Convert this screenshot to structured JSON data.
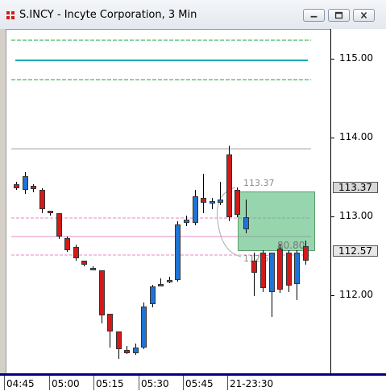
{
  "window": {
    "title": "S.INCY - Incyte Corporation, 3 Min",
    "controls": {
      "minimize": "minimize",
      "restore": "restore",
      "close": "close"
    }
  },
  "colors": {
    "up_candle": "#1e74d6",
    "down_candle": "#d21a1a",
    "target_band": "#1aa63a",
    "center_line": "#19a9b4",
    "pink_line": "#e589c7",
    "zone": "#5cb878",
    "selection_border": "#000082"
  },
  "chart_data": {
    "type": "candlestick",
    "y_ticks": [
      "115.00",
      "114.00",
      "113.00",
      "112.00"
    ],
    "x_ticks": [
      "04:45",
      "05:00",
      "05:15",
      "05:30",
      "05:45",
      "21-23:30"
    ],
    "ylim": [
      111.05,
      115.35
    ],
    "price_labels": {
      "upper": "113.37",
      "last": "112.57"
    },
    "zone_labels": {
      "top": "113.37",
      "value": "80.80",
      "bottom": "112.5"
    },
    "levels": {
      "green_top": 115.25,
      "cyan": 115.0,
      "green_low": 114.74,
      "gray": 113.87,
      "pink_top": 112.99,
      "pink_mid": 112.76,
      "pink_low": 112.52
    },
    "candles": [
      {
        "t": "04:42",
        "o": 113.42,
        "h": 113.45,
        "l": 113.35,
        "c": 113.37
      },
      {
        "t": "04:45",
        "o": 113.35,
        "h": 113.57,
        "l": 113.3,
        "c": 113.52
      },
      {
        "t": "04:48",
        "o": 113.4,
        "h": 113.42,
        "l": 113.32,
        "c": 113.36
      },
      {
        "t": "04:51",
        "o": 113.35,
        "h": 113.37,
        "l": 113.05,
        "c": 113.1
      },
      {
        "t": "04:54",
        "o": 113.08,
        "h": 113.08,
        "l": 113.02,
        "c": 113.05
      },
      {
        "t": "04:57",
        "o": 113.05,
        "h": 113.05,
        "l": 112.72,
        "c": 112.75
      },
      {
        "t": "05:00",
        "o": 112.73,
        "h": 112.76,
        "l": 112.56,
        "c": 112.58
      },
      {
        "t": "05:03",
        "o": 112.62,
        "h": 112.65,
        "l": 112.45,
        "c": 112.48
      },
      {
        "t": "05:06",
        "o": 112.45,
        "h": 112.45,
        "l": 112.38,
        "c": 112.4
      },
      {
        "t": "05:09",
        "o": 112.36,
        "h": 112.38,
        "l": 112.35,
        "c": 112.36
      },
      {
        "t": "05:12",
        "o": 112.33,
        "h": 112.33,
        "l": 111.65,
        "c": 111.75
      },
      {
        "t": "05:15",
        "o": 111.78,
        "h": 111.78,
        "l": 111.35,
        "c": 111.55
      },
      {
        "t": "05:18",
        "o": 111.55,
        "h": 111.55,
        "l": 111.2,
        "c": 111.33
      },
      {
        "t": "05:21",
        "o": 111.32,
        "h": 111.37,
        "l": 111.27,
        "c": 111.28
      },
      {
        "t": "05:24",
        "o": 111.28,
        "h": 111.4,
        "l": 111.26,
        "c": 111.35
      },
      {
        "t": "05:27",
        "o": 111.35,
        "h": 111.92,
        "l": 111.33,
        "c": 111.87
      },
      {
        "t": "05:30",
        "o": 111.9,
        "h": 112.14,
        "l": 111.86,
        "c": 112.12
      },
      {
        "t": "05:33",
        "o": 112.13,
        "h": 112.22,
        "l": 112.12,
        "c": 112.15
      },
      {
        "t": "05:36",
        "o": 112.18,
        "h": 112.24,
        "l": 112.16,
        "c": 112.2
      },
      {
        "t": "05:39",
        "o": 112.2,
        "h": 112.95,
        "l": 112.18,
        "c": 112.91
      },
      {
        "t": "05:42",
        "o": 112.93,
        "h": 113.02,
        "l": 112.89,
        "c": 112.97
      },
      {
        "t": "05:45",
        "o": 112.93,
        "h": 113.35,
        "l": 112.9,
        "c": 113.27
      },
      {
        "t": "05:48",
        "o": 113.25,
        "h": 113.55,
        "l": 113.05,
        "c": 113.18
      },
      {
        "t": "05:51",
        "o": 113.18,
        "h": 113.25,
        "l": 113.1,
        "c": 113.2
      },
      {
        "t": "05:54",
        "o": 113.18,
        "h": 113.45,
        "l": 113.15,
        "c": 113.22
      },
      {
        "t": "05:57",
        "o": 113.8,
        "h": 113.91,
        "l": 112.95,
        "c": 113.0
      },
      {
        "t": "06:00",
        "o": 113.35,
        "h": 113.38,
        "l": 113.0,
        "c": 113.03
      },
      {
        "t": "06:03",
        "o": 112.85,
        "h": 113.22,
        "l": 112.8,
        "c": 113.0
      },
      {
        "t": "06:06",
        "o": 112.45,
        "h": 112.55,
        "l": 112.0,
        "c": 112.3
      },
      {
        "t": "06:09",
        "o": 112.55,
        "h": 112.58,
        "l": 112.05,
        "c": 112.1
      },
      {
        "t": "06:12",
        "o": 112.05,
        "h": 112.55,
        "l": 111.73,
        "c": 112.55
      },
      {
        "t": "06:15",
        "o": 112.6,
        "h": 112.66,
        "l": 112.04,
        "c": 112.08
      },
      {
        "t": "06:18",
        "o": 112.55,
        "h": 112.58,
        "l": 112.05,
        "c": 112.13
      },
      {
        "t": "06:21",
        "o": 112.15,
        "h": 112.58,
        "l": 111.95,
        "c": 112.55
      },
      {
        "t": "06:24",
        "o": 112.63,
        "h": 112.7,
        "l": 112.4,
        "c": 112.45
      }
    ]
  }
}
